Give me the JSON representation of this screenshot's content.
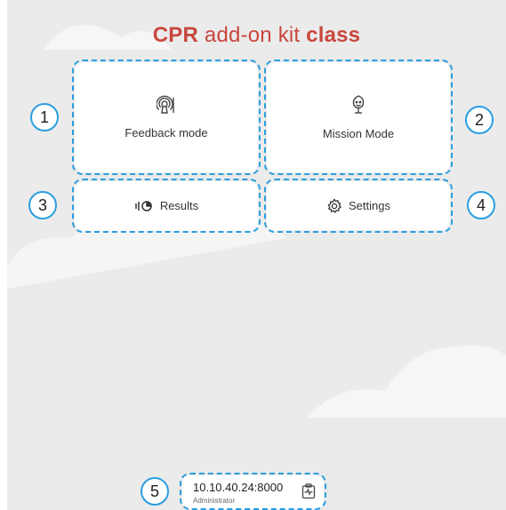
{
  "header": {
    "title_bold": "CPR",
    "title_regular": " add-on kit ",
    "title_bold_end": "class"
  },
  "menu": {
    "feedback_label": "Feedback mode",
    "mission_label": "Mission Mode",
    "results_label": "Results",
    "settings_label": "Settings"
  },
  "server": {
    "address": "10.10.40.24:8000",
    "role": "Administrator"
  },
  "markers": [
    "1",
    "2",
    "3",
    "4",
    "5"
  ],
  "colors": {
    "brand": "#c8473d",
    "annotation": "#2a9ee0",
    "background": "#ebebeb"
  },
  "icons": {
    "feedback": "feedback-mode-icon",
    "mission": "mission-mode-icon",
    "results": "results-icon",
    "settings": "gear-icon",
    "server": "server-status-icon"
  }
}
